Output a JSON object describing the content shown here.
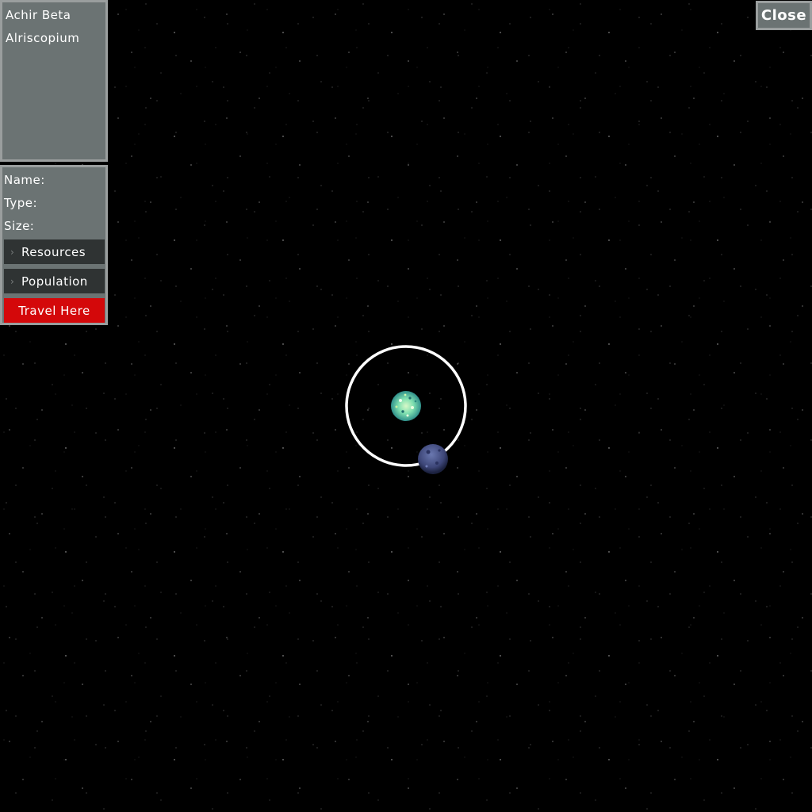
{
  "systems": [
    {
      "label": "Achir Beta"
    },
    {
      "label": "Alriscopium"
    }
  ],
  "info": {
    "name_label": "Name:",
    "type_label": "Type:",
    "size_label": "Size:",
    "resources_label": "Resources",
    "population_label": "Population",
    "travel_label": "Travel Here"
  },
  "close_label": "Close",
  "icons": {
    "expander": "chevron-right-icon",
    "star": "star-icon",
    "planet": "planet-icon",
    "orbit": "orbit-ring"
  },
  "colors": {
    "background": "#000000",
    "panel": "#6b7373",
    "panel_border": "#9a9e9e",
    "expander_bg": "#2f3333",
    "travel_button": "#d4080a",
    "star_green": "#7fe0b0",
    "planet_blue": "#4a5588",
    "orbit": "#ffffff"
  }
}
